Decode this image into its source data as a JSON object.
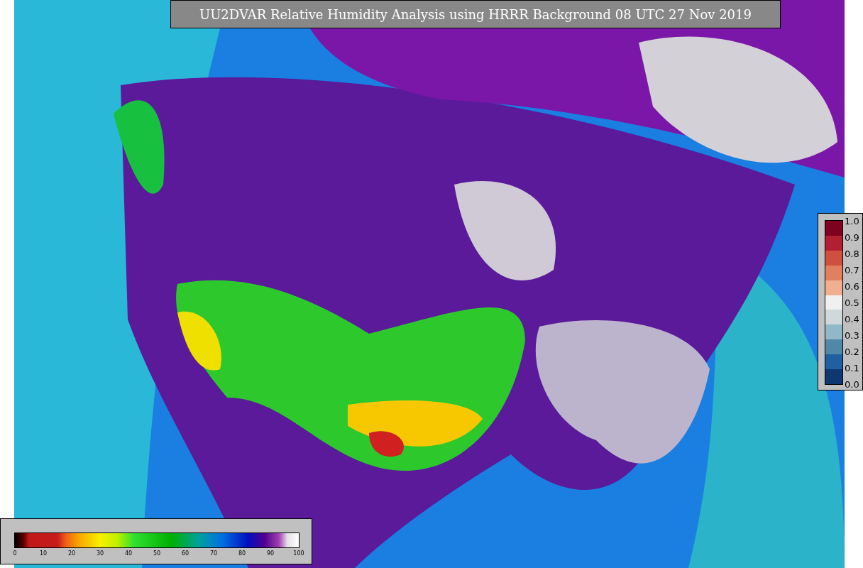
{
  "title": "UU2DVAR Relative Humidity Analysis using HRRR Background 08 UTC 27 Nov 2019",
  "humidity_colorbar": {
    "ticks": [
      "0",
      "10",
      "20",
      "30",
      "40",
      "50",
      "60",
      "70",
      "80",
      "90",
      "100"
    ]
  },
  "ratio_colorbar": {
    "ticks": [
      "1.0",
      "0.9",
      "0.8",
      "0.7",
      "0.6",
      "0.5",
      "0.4",
      "0.3",
      "0.2",
      "0.1",
      "0.0"
    ]
  }
}
